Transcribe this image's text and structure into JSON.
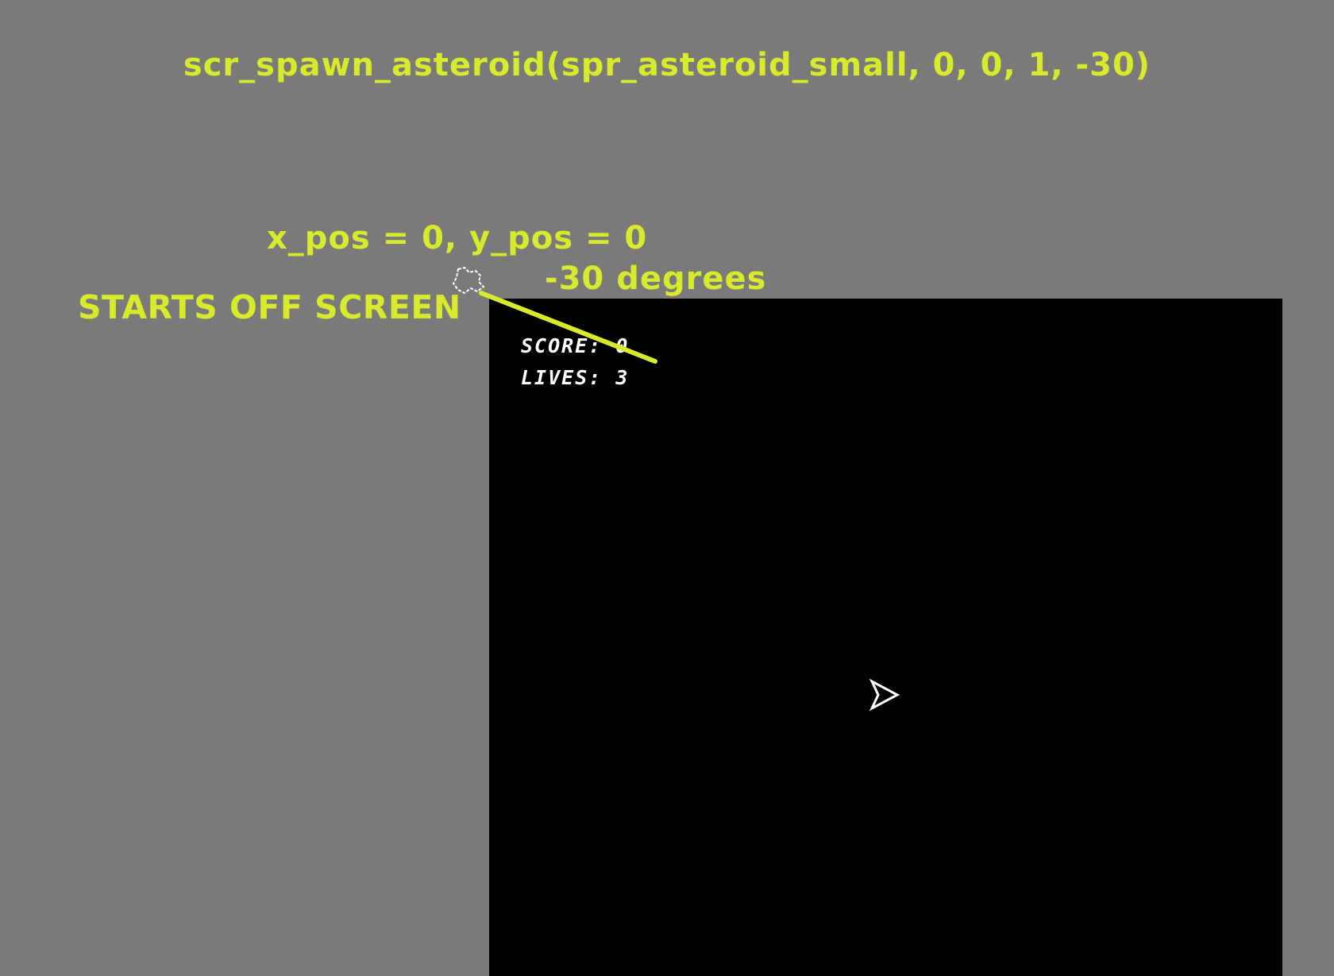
{
  "annotations": {
    "title": "scr_spawn_asteroid(spr_asteroid_small, 0, 0, 1, -30)",
    "position": "x_pos = 0, y_pos = 0",
    "angle": "-30 degrees",
    "offscreen": "STARTS OFF SCREEN"
  },
  "hud": {
    "score_label": "SCORE:",
    "score_value": "0",
    "lives_label": "LIVES:",
    "lives_value": "3"
  },
  "sprites": {
    "asteroid": "asteroid-small-icon",
    "ship": "player-ship-icon"
  },
  "colors": {
    "annotation": "#d7ea2c",
    "background": "#7a7a7a",
    "game_view": "#000000",
    "hud_text": "#ffffff"
  }
}
